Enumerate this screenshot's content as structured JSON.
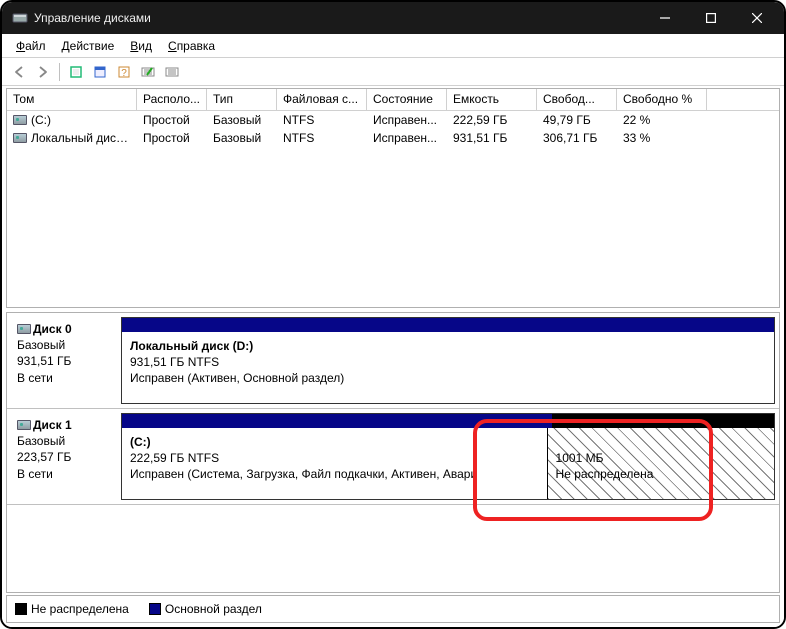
{
  "window": {
    "title": "Управление дисками"
  },
  "menubar": {
    "file": "Файл",
    "action": "Действие",
    "view": "Вид",
    "help": "Справка"
  },
  "columns": {
    "volume": "Том",
    "layout": "Располо...",
    "type": "Тип",
    "fs": "Файловая с...",
    "status": "Состояние",
    "capacity": "Емкость",
    "free": "Свобод...",
    "freePct": "Свободно %"
  },
  "volumes": [
    {
      "name": "(C:)",
      "layout": "Простой",
      "type": "Базовый",
      "fs": "NTFS",
      "status": "Исправен...",
      "capacity": "222,59 ГБ",
      "free": "49,79 ГБ",
      "pct": "22 %"
    },
    {
      "name": "Локальный диск (...",
      "layout": "Простой",
      "type": "Базовый",
      "fs": "NTFS",
      "status": "Исправен...",
      "capacity": "931,51 ГБ",
      "free": "306,71 ГБ",
      "pct": "33 %"
    }
  ],
  "disks": [
    {
      "name": "Диск 0",
      "type": "Базовый",
      "size": "931,51 ГБ",
      "state": "В сети",
      "parts": [
        {
          "kind": "primary",
          "title": "Локальный диск  (D:)",
          "line2": "931,51 ГБ NTFS",
          "line3": "Исправен (Активен, Основной раздел)",
          "flex": 1
        }
      ]
    },
    {
      "name": "Диск 1",
      "type": "Базовый",
      "size": "223,57 ГБ",
      "state": "В сети",
      "parts": [
        {
          "kind": "primary",
          "title": "(C:)",
          "line2": "222,59 ГБ NTFS",
          "line3": "Исправен (Система, Загрузка, Файл подкачки, Активен, Авари",
          "flex": 0.66
        },
        {
          "kind": "unallocated",
          "title": "",
          "line2": "1001 МБ",
          "line3": "Не распределена",
          "flex": 0.34
        }
      ]
    }
  ],
  "legend": {
    "unallocated": "Не распределена",
    "primary": "Основной раздел"
  }
}
